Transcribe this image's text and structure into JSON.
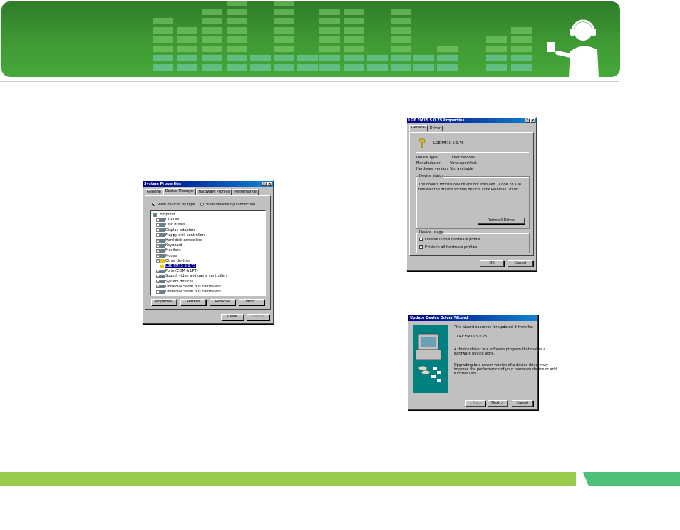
{
  "system_properties": {
    "title": "System Properties",
    "tabs": [
      "General",
      "Device Manager",
      "Hardware Profiles",
      "Performance"
    ],
    "radio_by_type": "View devices by type",
    "radio_by_connection": "View devices by connection",
    "tree": [
      {
        "label": "Computer",
        "level": 0,
        "icon": "computer-icon"
      },
      {
        "label": "CDROM",
        "level": 1,
        "icon": "cdrom-icon"
      },
      {
        "label": "Disk drives",
        "level": 1,
        "icon": "disk-icon"
      },
      {
        "label": "Display adapters",
        "level": 1,
        "icon": "display-icon"
      },
      {
        "label": "Floppy disk controllers",
        "level": 1,
        "icon": "floppy-icon"
      },
      {
        "label": "Hard disk controllers",
        "level": 1,
        "icon": "harddisk-icon"
      },
      {
        "label": "Keyboard",
        "level": 1,
        "icon": "keyboard-icon"
      },
      {
        "label": "Monitors",
        "level": 1,
        "icon": "monitor-icon"
      },
      {
        "label": "Mouse",
        "level": 1,
        "icon": "mouse-icon"
      },
      {
        "label": "Other devices",
        "level": 1,
        "icon": "question-icon"
      },
      {
        "label": "LGE FM15 S 0.75",
        "level": 2,
        "icon": "question-icon",
        "selected": true
      },
      {
        "label": "Ports (COM & LPT)",
        "level": 1,
        "icon": "port-icon"
      },
      {
        "label": "Sound, video and game controllers",
        "level": 1,
        "icon": "sound-icon"
      },
      {
        "label": "System devices",
        "level": 1,
        "icon": "system-icon"
      },
      {
        "label": "Universal Serial Bus controllers",
        "level": 1,
        "icon": "usb-icon"
      },
      {
        "label": "Universal Serial Bus controllers",
        "level": 1,
        "icon": "usb-icon"
      }
    ],
    "buttons": {
      "properties": "Properties",
      "refresh": "Refresh",
      "remove": "Remove",
      "print": "Print..."
    },
    "close": "Close",
    "cancel": "Cancel"
  },
  "lge_properties": {
    "title": "LGE FM15 S 0.75  Properties",
    "tabs": [
      "General",
      "Driver"
    ],
    "device_name": "LGE FM15 S 0.75",
    "fields": [
      {
        "key": "Device type:",
        "value": "Other devices"
      },
      {
        "key": "Manufacturer:",
        "value": "None specified."
      },
      {
        "key": "Hardware version:",
        "value": "Not available"
      }
    ],
    "status_group": "Device status",
    "status_text_1": "The drivers for this device are not installed. (Code 28.) To",
    "status_text_2": "reinstall the drivers for this device, click Reinstall Driver.",
    "reinstall": "Reinstall Driver",
    "usage_group": "Device usage",
    "usage_disable": "Disable in this hardware profile",
    "usage_exists": "Exists in all hardware profiles",
    "ok": "OK",
    "cancel": "Cancel"
  },
  "wizard": {
    "title": "Update Device Driver Wizard",
    "line1": "This wizard searches for updated drivers for:",
    "device": "LGE FM15 S 0.75",
    "para1a": "A device driver is a software program that makes a",
    "para1b": "hardware device work.",
    "para2a": "Upgrading to a newer version of a device driver may",
    "para2b": "improve the performance of your hardware device or add",
    "para2c": "functionality.",
    "back": "< Back",
    "next": "Next >",
    "cancel": "Cancel"
  },
  "colors": {
    "banner": "#3f9a33",
    "footer_green": "#99cc4a",
    "footer_tab": "#4dc07a",
    "win_title": "#000080"
  }
}
